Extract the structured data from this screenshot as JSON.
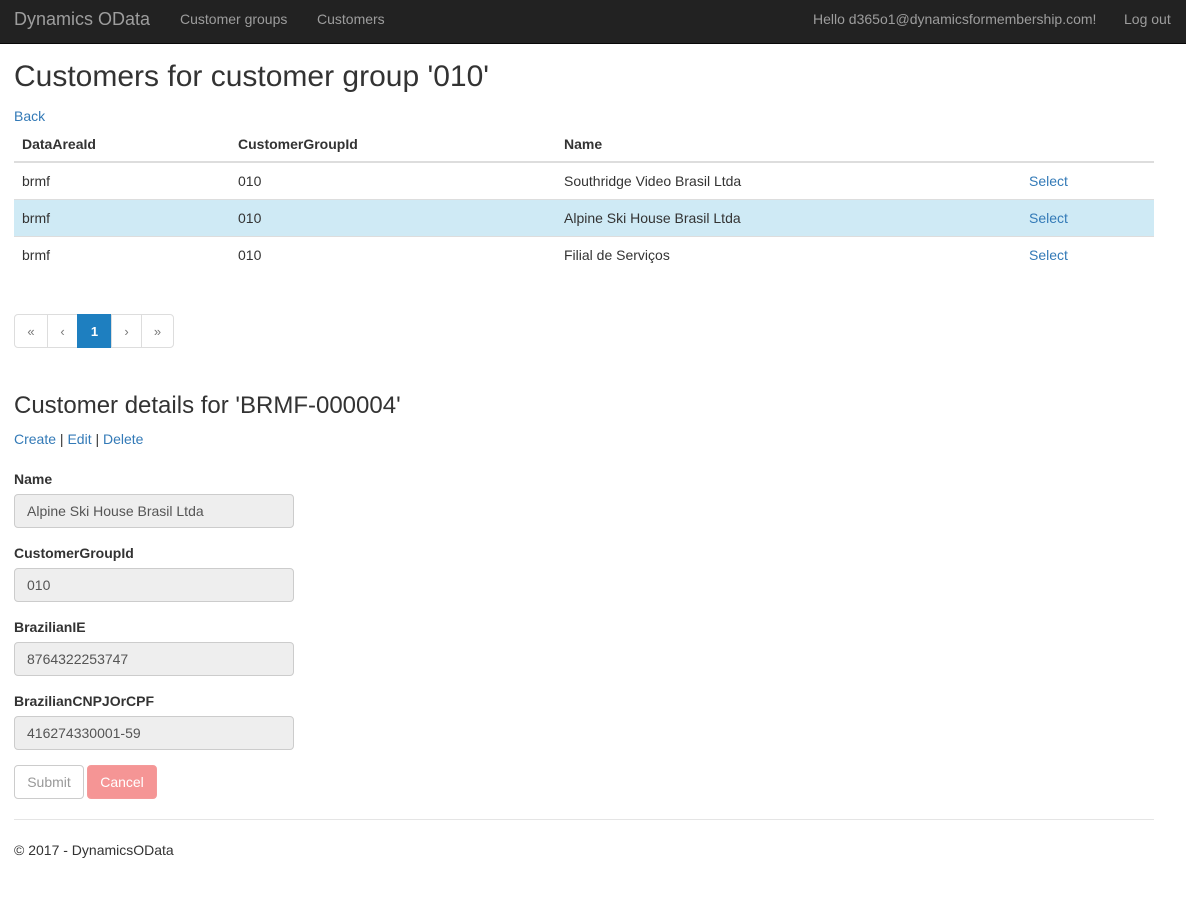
{
  "navbar": {
    "brand": "Dynamics OData",
    "links": [
      "Customer groups",
      "Customers"
    ],
    "greeting": "Hello d365o1@dynamicsformembership.com!",
    "logout": "Log out"
  },
  "page": {
    "title": "Customers for customer group '010'",
    "back": "Back"
  },
  "table": {
    "headers": [
      "DataAreaId",
      "CustomerGroupId",
      "Name",
      ""
    ],
    "rows": [
      {
        "dataAreaId": "brmf",
        "customerGroupId": "010",
        "name": "Southridge Video Brasil Ltda",
        "action": "Select"
      },
      {
        "dataAreaId": "brmf",
        "customerGroupId": "010",
        "name": "Alpine Ski House Brasil Ltda",
        "action": "Select"
      },
      {
        "dataAreaId": "brmf",
        "customerGroupId": "010",
        "name": "Filial de Serviços",
        "action": "Select"
      }
    ]
  },
  "pager": {
    "first": "«",
    "prev": "‹",
    "current": "1",
    "next": "›",
    "last": "»"
  },
  "details": {
    "title": "Customer details for 'BRMF-000004'",
    "actions": {
      "create": "Create",
      "separator": "|",
      "edit": "Edit",
      "delete": "Delete"
    },
    "fields": [
      {
        "label": "Name",
        "value": "Alpine Ski House Brasil Ltda"
      },
      {
        "label": "CustomerGroupId",
        "value": "010"
      },
      {
        "label": "BrazilianIE",
        "value": "8764322253747"
      },
      {
        "label": "BrazilianCNPJOrCPF",
        "value": "416274330001-59"
      }
    ],
    "submit": "Submit",
    "cancel": "Cancel"
  },
  "footer": {
    "text": "© 2017 - DynamicsOData"
  }
}
